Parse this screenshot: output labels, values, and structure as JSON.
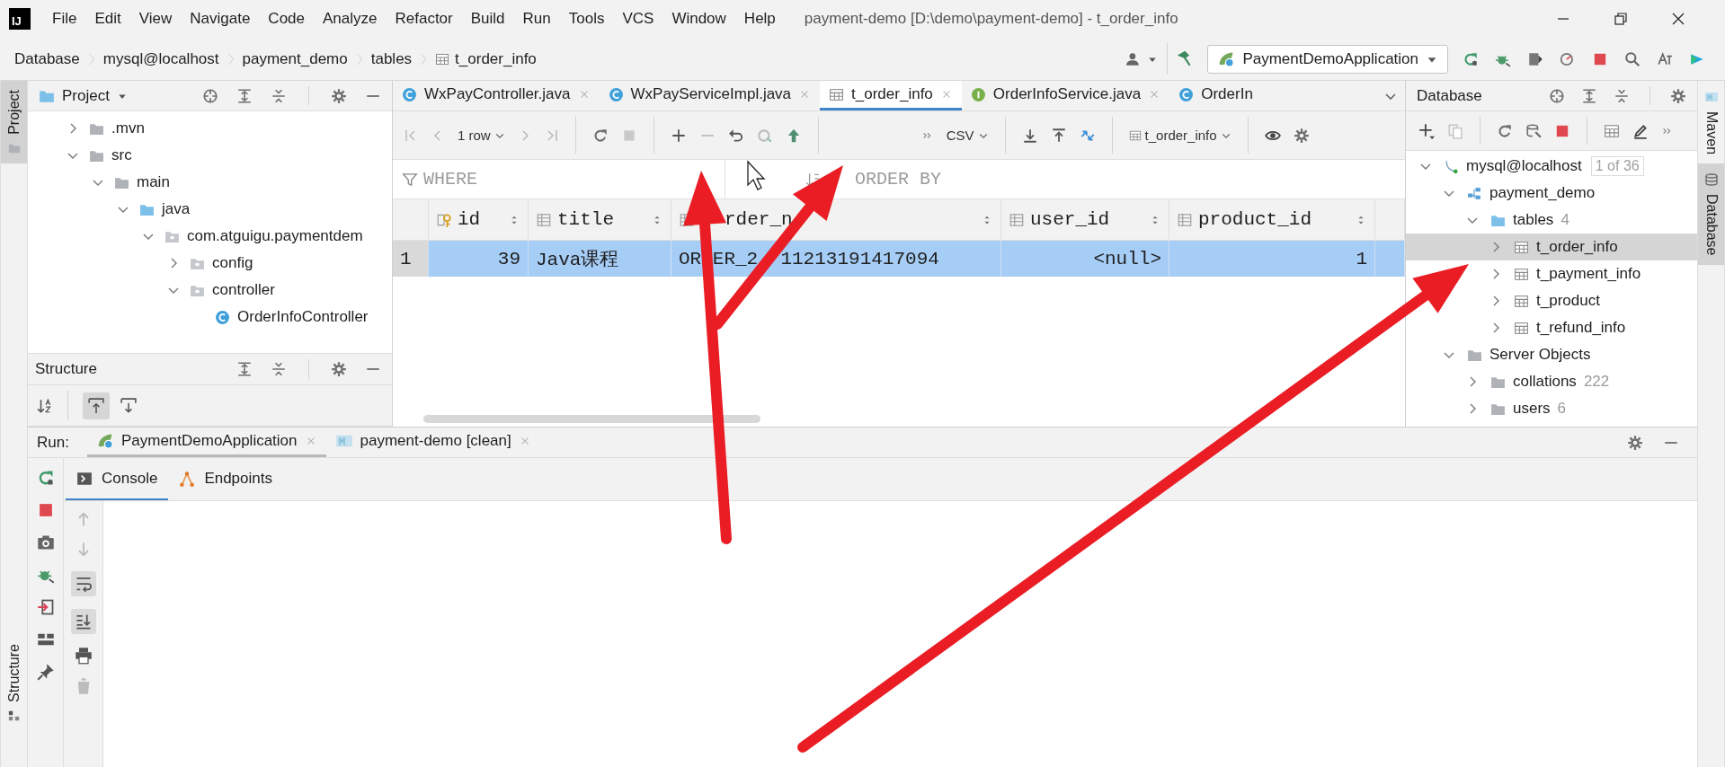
{
  "logo_text": "IJ",
  "menu": [
    "File",
    "Edit",
    "View",
    "Navigate",
    "Code",
    "Analyze",
    "Refactor",
    "Build",
    "Run",
    "Tools",
    "VCS",
    "Window",
    "Help"
  ],
  "window_title": "payment-demo [D:\\demo\\payment-demo] - t_order_info",
  "breadcrumbs": [
    "Database",
    "mysql@localhost",
    "payment_demo",
    "tables",
    "t_order_info"
  ],
  "run_config": "PaymentDemoApplication",
  "left_strip": [
    {
      "label": "Project",
      "selected": true
    },
    {
      "label": "Structure",
      "selected": false
    }
  ],
  "right_strip": [
    {
      "label": "Maven",
      "selected": false
    },
    {
      "label": "Database",
      "selected": true
    }
  ],
  "project": {
    "title": "Project",
    "tree": [
      {
        "label": ".mvn",
        "kind": "folder",
        "expanded": false
      },
      {
        "label": "src",
        "kind": "folder",
        "expanded": true,
        "children": [
          {
            "label": "main",
            "kind": "folder",
            "expanded": true,
            "children": [
              {
                "label": "java",
                "kind": "source",
                "expanded": true,
                "children": [
                  {
                    "label": "com.atguigu.paymentdem",
                    "kind": "package",
                    "expanded": true,
                    "children": [
                      {
                        "label": "config",
                        "kind": "package",
                        "expanded": false
                      },
                      {
                        "label": "controller",
                        "kind": "package",
                        "expanded": true,
                        "children": [
                          {
                            "label": "OrderInfoController",
                            "kind": "class"
                          }
                        ]
                      }
                    ]
                  }
                ]
              }
            ]
          }
        ]
      }
    ]
  },
  "structure": {
    "title": "Structure"
  },
  "editor_tabs": [
    {
      "label": "WxPayController.java",
      "kind": "class",
      "selected": false,
      "closable": true
    },
    {
      "label": "WxPayServiceImpl.java",
      "kind": "class",
      "selected": false,
      "closable": true
    },
    {
      "label": "t_order_info",
      "kind": "table",
      "selected": true,
      "closable": true
    },
    {
      "label": "OrderInfoService.java",
      "kind": "interface",
      "selected": false,
      "closable": true
    },
    {
      "label": "OrderIn",
      "kind": "class",
      "selected": false,
      "closable": false
    }
  ],
  "grid_toolbar": {
    "rows": "1 row",
    "format": "CSV",
    "table": "t_order_info"
  },
  "filters": [
    {
      "kind": "where",
      "placeholder": "WHERE"
    },
    {
      "kind": "order",
      "placeholder": "ORDER BY"
    }
  ],
  "table": {
    "columns": [
      {
        "label": "id",
        "kind": "number",
        "primary_key": true
      },
      {
        "label": "title",
        "kind": "text",
        "primary_key": false
      },
      {
        "label": "rder_n",
        "kind": "text",
        "primary_key": false
      },
      {
        "label": "user_id",
        "kind": "number",
        "primary_key": false
      },
      {
        "label": "product_id",
        "kind": "number",
        "primary_key": false
      }
    ],
    "rows": [
      {
        "number": "1",
        "selected": true,
        "cells": [
          "39",
          "Java课程",
          "OR ER_2  11213191417094",
          "<null>",
          "1"
        ]
      }
    ]
  },
  "database": {
    "title": "Database",
    "tree": [
      {
        "label": "mysql@localhost",
        "kind": "datasource",
        "badge": "1 of 36",
        "expanded": true,
        "selected": false,
        "children": [
          {
            "label": "payment_demo",
            "kind": "schema",
            "expanded": true,
            "selected": false,
            "children": [
              {
                "label": "tables",
                "kind": "folder-blue",
                "count": "4",
                "expanded": true,
                "selected": false,
                "children": [
                  {
                    "label": "t_order_info",
                    "kind": "table",
                    "expanded": false,
                    "selected": true
                  },
                  {
                    "label": "t_payment_info",
                    "kind": "table",
                    "expanded": false,
                    "selected": false
                  },
                  {
                    "label": "t_product",
                    "kind": "table",
                    "expanded": false,
                    "selected": false
                  },
                  {
                    "label": "t_refund_info",
                    "kind": "table",
                    "expanded": false,
                    "selected": false
                  }
                ]
              }
            ]
          },
          {
            "label": "Server Objects",
            "kind": "folder",
            "expanded": true,
            "selected": false,
            "children": [
              {
                "label": "collations",
                "kind": "folder",
                "count": "222",
                "expanded": false,
                "selected": false
              },
              {
                "label": "users",
                "kind": "folder",
                "count": "6",
                "expanded": false,
                "selected": false
              }
            ]
          }
        ]
      }
    ]
  },
  "run": {
    "label": "Run:",
    "tabs": [
      {
        "label": "PaymentDemoApplication",
        "kind": "spring",
        "selected": true
      },
      {
        "label": "payment-demo [clean]",
        "kind": "maven",
        "selected": false
      }
    ],
    "subtabs": [
      {
        "label": "Console",
        "kind": "console",
        "selected": true
      },
      {
        "label": "Endpoints",
        "kind": "endpoints",
        "selected": false
      }
    ]
  }
}
